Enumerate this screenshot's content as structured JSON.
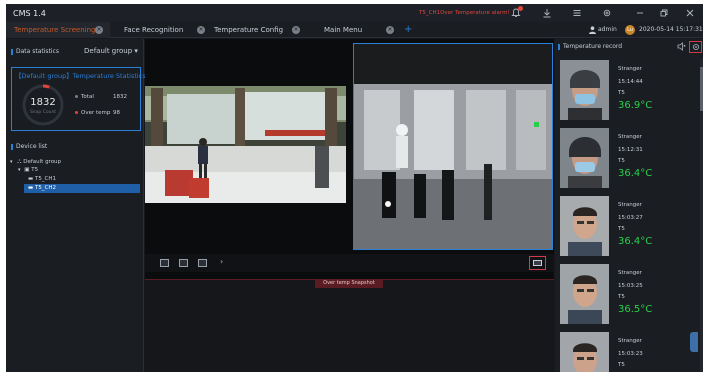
{
  "app": {
    "title": "CMS 1.4"
  },
  "alarm": {
    "text": "T5_CH1Over Temperature alarm!"
  },
  "colors": {
    "accent": "#2a7fd6",
    "active_tab": "#c25a2d",
    "alarm": "#e0463b",
    "temp_ok": "#28d04a",
    "highlight": "#d33a4a"
  },
  "tabs": [
    {
      "label": "Temperature Screening",
      "active": true
    },
    {
      "label": "Face Recognition",
      "active": false
    },
    {
      "label": "Temperature Config",
      "active": false
    },
    {
      "label": "Main Menu",
      "active": false
    }
  ],
  "tab_add": "+",
  "user": {
    "name": "admin",
    "avatar_initials": "Lu",
    "datetime": "2020-05-14 15:17:31"
  },
  "data_statistics": {
    "title": "Data statistics",
    "group": "Default group ▾",
    "box_title": "【Default group】Temperature Statistics",
    "snap_count": "1832",
    "snap_label": "Snap Count",
    "total_label": "Total",
    "total_value": "1832",
    "over_label": "Over temp",
    "over_value": "98",
    "over_fraction": 0.053
  },
  "device_list": {
    "title": "Device list",
    "items": [
      {
        "label": "Default group"
      },
      {
        "label": "T5"
      },
      {
        "label": "T5_CH1"
      },
      {
        "label": "T5_CH2"
      }
    ]
  },
  "snapshot": {
    "tab_label": "Over temp Snapshot"
  },
  "toolbar": {
    "arrow": "›"
  },
  "temperature_record": {
    "title": "Temperature record",
    "records": [
      {
        "name": "Stranger",
        "time": "15:14:44",
        "device": "T5",
        "temp": "36.9°C"
      },
      {
        "name": "Stranger",
        "time": "15:12:31",
        "device": "T5",
        "temp": "36.4°C"
      },
      {
        "name": "Stranger",
        "time": "15:03:27",
        "device": "T5",
        "temp": "36.4°C"
      },
      {
        "name": "Stranger",
        "time": "15:03:25",
        "device": "T5",
        "temp": "36.5°C"
      },
      {
        "name": "Stranger",
        "time": "15:03:23",
        "device": "T5",
        "temp": ""
      }
    ]
  }
}
